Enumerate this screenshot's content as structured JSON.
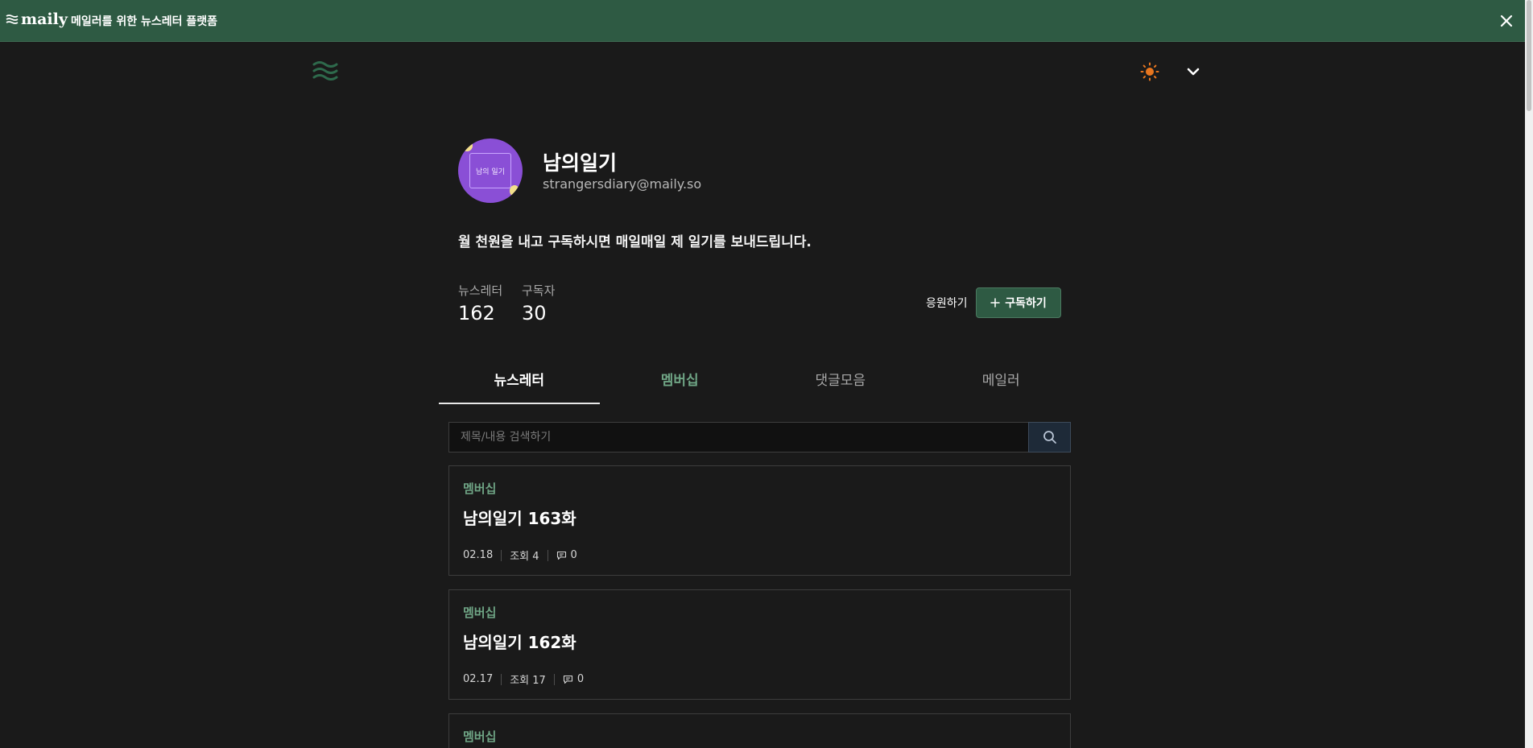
{
  "banner": {
    "logo": "maily",
    "tagline": "메일러를 위한 뉴스레터 플랫폼"
  },
  "profile": {
    "name": "남의일기",
    "email": "strangersdiary@maily.so",
    "avatar_text": "남의 일기",
    "description": "월 천원을 내고 구독하시면 매일매일 제 일기를 보내드립니다."
  },
  "stats": [
    {
      "label": "뉴스레터",
      "value": "162"
    },
    {
      "label": "구독자",
      "value": "30"
    }
  ],
  "actions": {
    "support": "응원하기",
    "subscribe": "구독하기"
  },
  "tabs": [
    {
      "label": "뉴스레터"
    },
    {
      "label": "멤버십"
    },
    {
      "label": "댓글모음"
    },
    {
      "label": "메일러"
    }
  ],
  "search": {
    "placeholder": "제목/내용 검색하기"
  },
  "posts": [
    {
      "tag": "멤버십",
      "title": "남의일기 163화",
      "date": "02.18",
      "views": "조회 4",
      "comments": "0"
    },
    {
      "tag": "멤버십",
      "title": "남의일기 162화",
      "date": "02.17",
      "views": "조회 17",
      "comments": "0"
    },
    {
      "tag": "멤버십",
      "title": "",
      "date": "",
      "views": "",
      "comments": ""
    }
  ],
  "colors": {
    "brand": "#2e5a43",
    "membership": "#6fa585",
    "theme_icon": "#e8761f",
    "background": "#1a1a1a"
  },
  "icons": [
    "maily-logo-icon",
    "close-icon",
    "waves-logo-icon",
    "sun-icon",
    "chevron-down-icon",
    "plus-icon",
    "search-icon",
    "comment-icon"
  ]
}
